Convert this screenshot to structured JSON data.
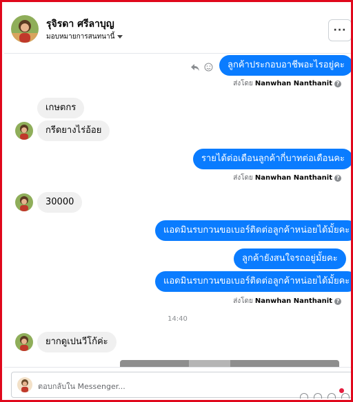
{
  "header": {
    "contact_name": "รุจิรดา ศรีลาบุญ",
    "assign_label": "มอบหมายการสนทนานี้",
    "more_label": "···"
  },
  "messages": [
    {
      "direction": "out",
      "text": "ลูกค้าประกอบอาชีพอะไรอยู่คะ"
    },
    {
      "direction": "in",
      "text": "เกษตกร"
    },
    {
      "direction": "in",
      "text": "กรีดยางไร่อ้อย"
    },
    {
      "direction": "out",
      "text": "รายได้ต่อเดือนลูกค้ากี่บาทต่อเดือนคะ"
    },
    {
      "direction": "in",
      "text": "30000"
    },
    {
      "direction": "out",
      "text": "แอดมินรบกวนขอเบอร์ติดต่อลูกค้าหน่อยได้มั้ยคะ"
    },
    {
      "direction": "out",
      "text": "ลูกค้ายังสนใจรถอยู่มั้ยคะ"
    },
    {
      "direction": "out",
      "text": "แอดมินรบกวนขอเบอร์ติดต่อลูกค้าหน่อยได้มั้ยคะ"
    },
    {
      "direction": "in",
      "text": "ยากดูเปนวีโก้ค่ะ"
    }
  ],
  "sent_by": {
    "prefix": "ส่งโดย",
    "agent": "Nanwhan Nanthanit"
  },
  "timestamp": "14:40",
  "composer": {
    "placeholder": "ตอบกลับใน Messenger..."
  },
  "colors": {
    "outgoing_bubble": "#0a7cff",
    "incoming_bubble": "#f0f0f0",
    "border_frame": "#e0081c"
  },
  "icons": [
    "reply-icon",
    "emoji-icon",
    "help-icon",
    "more-icon",
    "chevron-down-icon"
  ]
}
